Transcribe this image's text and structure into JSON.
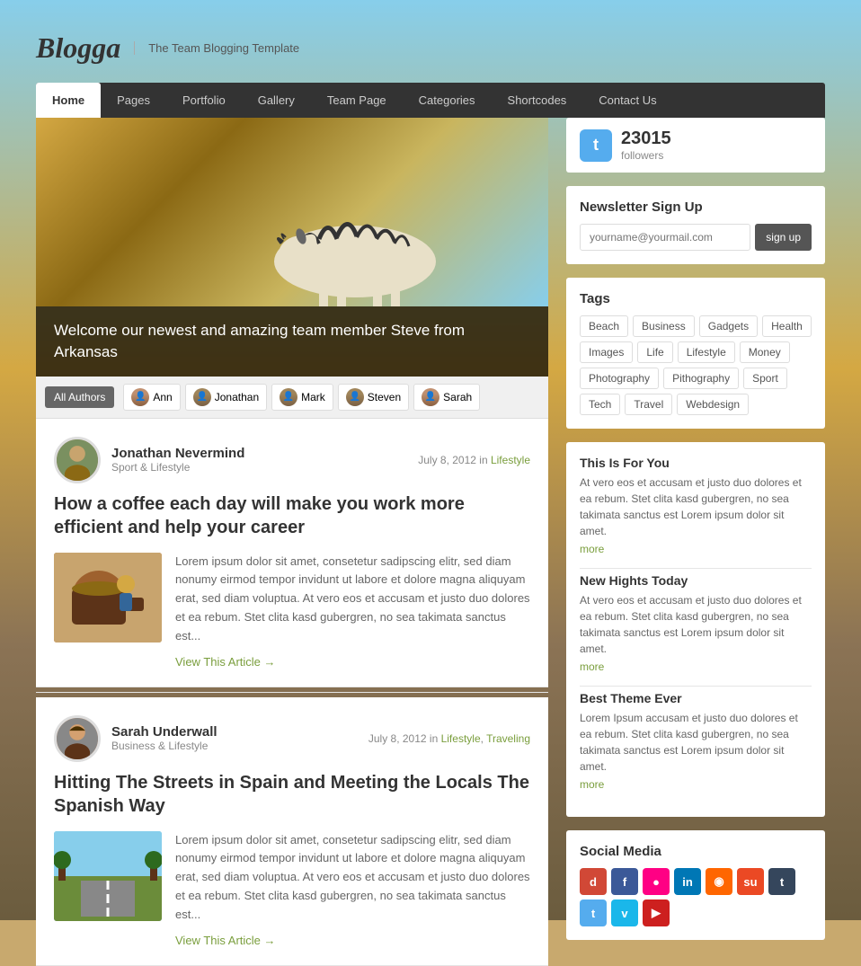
{
  "site": {
    "logo": "Blogga",
    "tagline": "The Team Blogging Template"
  },
  "nav": {
    "items": [
      {
        "label": "Home",
        "active": true
      },
      {
        "label": "Pages",
        "active": false
      },
      {
        "label": "Portfolio",
        "active": false
      },
      {
        "label": "Gallery",
        "active": false
      },
      {
        "label": "Team Page",
        "active": false
      },
      {
        "label": "Categories",
        "active": false
      },
      {
        "label": "Shortcodes",
        "active": false
      },
      {
        "label": "Contact Us",
        "active": false
      }
    ]
  },
  "hero": {
    "caption": "Welcome our newest and amazing team member Steve from Arkansas"
  },
  "authors_bar": {
    "all_label": "All Authors",
    "authors": [
      {
        "name": "Ann"
      },
      {
        "name": "Jonathan"
      },
      {
        "name": "Mark"
      },
      {
        "name": "Steven"
      },
      {
        "name": "Sarah"
      }
    ]
  },
  "articles": [
    {
      "author_name": "Jonathan Nevermind",
      "author_subtitle": "Sport & Lifestyle",
      "date": "July 8, 2012",
      "date_prefix": "in",
      "category": "Lifestyle",
      "category2": null,
      "title": "How a coffee each day will make you work more efficient and help your career",
      "excerpt": "Lorem ipsum dolor sit amet, consetetur sadipscing elitr, sed diam nonumy eirmod tempor invidunt ut labore et dolore magna aliquyam erat, sed diam voluptua. At vero eos et accusam et justo duo dolores et ea rebum. Stet clita kasd gubergren, no sea takimata sanctus est...",
      "view_label": "View This Article →",
      "thumb_type": "coffee"
    },
    {
      "author_name": "Sarah Underwall",
      "author_subtitle": "Business & Lifestyle",
      "date": "July 8, 2012",
      "date_prefix": "in",
      "category": "Lifestyle",
      "category2": "Traveling",
      "title": "Hitting The Streets in Spain and Meeting the Locals The Spanish Way",
      "excerpt": "Lorem ipsum dolor sit amet, consetetur sadipscing elitr, sed diam nonumy eirmod tempor invidunt ut labore et dolore magna aliquyam erat, sed diam voluptua. At vero eos et accusam et justo duo dolores et ea rebum. Stet clita kasd gubergren, no sea takimata sanctus est...",
      "view_label": "View This Article →",
      "thumb_type": "road"
    }
  ],
  "sidebar": {
    "twitter": {
      "followers_count": "23015",
      "followers_label": "followers"
    },
    "newsletter": {
      "title": "Newsletter Sign Up",
      "placeholder": "yourname@yourmail.com",
      "button_label": "sign up"
    },
    "tags": {
      "title": "Tags",
      "items": [
        "Beach",
        "Business",
        "Gadgets",
        "Health",
        "Images",
        "Life",
        "Lifestyle",
        "Money",
        "Photography",
        "Pithography",
        "Sport",
        "Tech",
        "Travel",
        "Webdesign"
      ]
    },
    "widgets": [
      {
        "title": "This Is For You",
        "body": "At vero eos et accusam et justo duo dolores et ea rebum. Stet clita kasd gubergren, no sea takimata sanctus est Lorem ipsum dolor sit amet.",
        "more": "more"
      },
      {
        "title": "New Hights Today",
        "body": "At vero eos et accusam et justo duo dolores et ea rebum. Stet clita kasd gubergren, no sea takimata sanctus est Lorem ipsum dolor sit amet.",
        "more": "more"
      },
      {
        "title": "Best Theme Ever",
        "body": "Lorem Ipsum accusam et justo duo dolores et ea rebum. Stet clita kasd gubergren, no sea takimata sanctus est Lorem ipsum dolor sit amet.",
        "more": "more"
      }
    ],
    "social": {
      "title": "Social Media",
      "icons": [
        {
          "name": "digg",
          "label": "d",
          "class": "si-digg"
        },
        {
          "name": "facebook",
          "label": "f",
          "class": "si-fb"
        },
        {
          "name": "flickr",
          "label": "✿",
          "class": "si-flickr"
        },
        {
          "name": "linkedin",
          "label": "in",
          "class": "si-li"
        },
        {
          "name": "rss",
          "label": "◉",
          "class": "si-rss"
        },
        {
          "name": "stumbleupon",
          "label": "su",
          "class": "si-su"
        },
        {
          "name": "tumblr",
          "label": "t",
          "class": "si-tumblr"
        },
        {
          "name": "twitter",
          "label": "t",
          "class": "si-tw"
        },
        {
          "name": "vimeo",
          "label": "v",
          "class": "si-vimeo"
        },
        {
          "name": "youtube",
          "label": "▶",
          "class": "si-yt"
        }
      ]
    }
  }
}
